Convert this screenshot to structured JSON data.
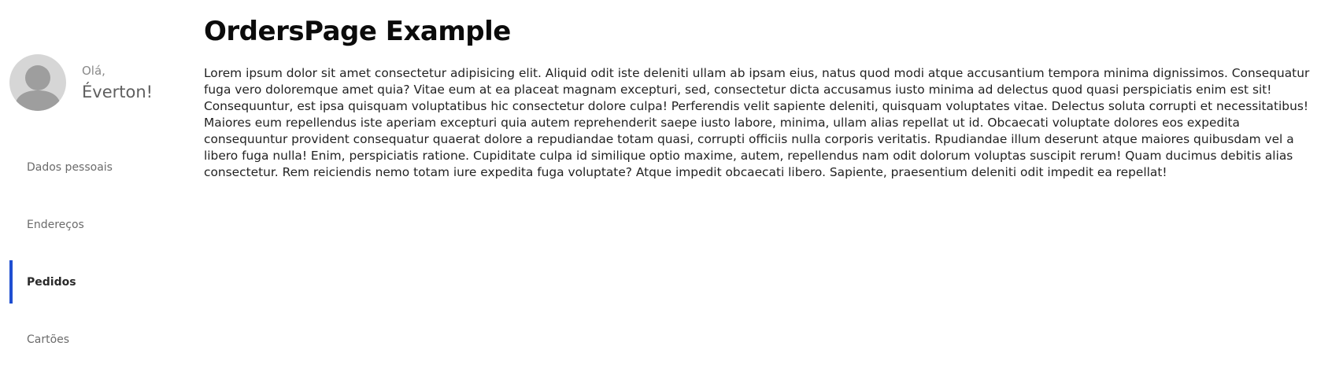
{
  "profile": {
    "greeting": "Olá,",
    "name": "Éverton!"
  },
  "sidebar": {
    "items": [
      {
        "label": "Dados pessoais"
      },
      {
        "label": "Endereços"
      },
      {
        "label": "Pedidos",
        "active": true
      },
      {
        "label": "Cartões"
      }
    ]
  },
  "main": {
    "title": "OrdersPage Example",
    "body": "Lorem ipsum dolor sit amet consectetur adipisicing elit. Aliquid odit iste deleniti ullam ab ipsam eius, natus quod modi atque accusantium tempora minima dignissimos. Consequatur fuga vero doloremque amet quia? Vitae eum at ea placeat magnam excepturi, sed, consectetur dicta accusamus iusto minima ad delectus quod quasi perspiciatis enim est sit! Consequuntur, est ipsa quisquam voluptatibus hic consectetur dolore culpa! Perferendis velit sapiente deleniti, quisquam voluptates vitae. Delectus soluta corrupti et necessitatibus! Maiores eum repellendus iste aperiam excepturi quia autem reprehenderit saepe iusto labore, minima, ullam alias repellat ut id. Obcaecati voluptate dolores eos expedita consequuntur provident consequatur quaerat dolore a repudiandae totam quasi, corrupti officiis nulla corporis veritatis. Rpudiandae illum deserunt atque maiores quibusdam vel a libero fuga nulla! Enim, perspiciatis ratione. Cupiditate culpa id similique optio maxime, autem, repellendus nam odit dolorum voluptas suscipit rerum! Quam ducimus debitis alias consectetur. Rem reiciendis nemo totam iure expedita fuga voluptate? Atque impedit obcaecati libero. Sapiente, praesentium deleniti odit impedit ea repellat!"
  },
  "colors": {
    "accent": "#1f4fd1",
    "avatar_bg": "#d6d6d6",
    "avatar_figure": "#9e9e9e"
  },
  "icons": {
    "avatar": "user-avatar-icon"
  }
}
